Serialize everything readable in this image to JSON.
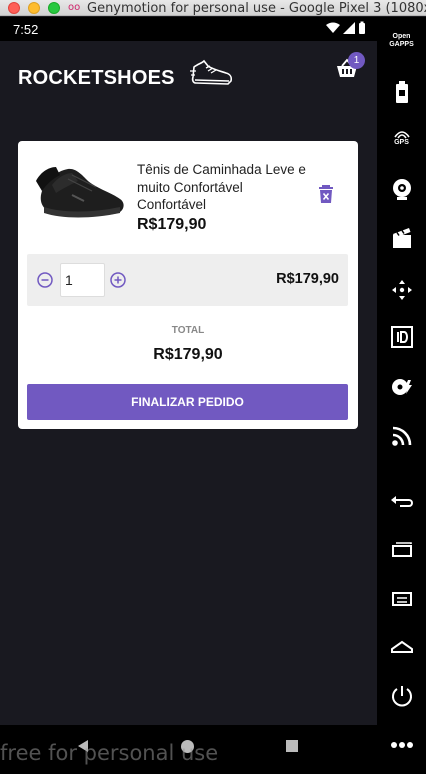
{
  "window": {
    "title": "Genymotion for personal use - Google Pixel 3 (1080x2",
    "logo_glyph": "oo"
  },
  "statusbar": {
    "time": "7:52"
  },
  "header": {
    "logo_text": "ROCKETSHOES",
    "cart_count": "1"
  },
  "cart": {
    "items": [
      {
        "title": "Tênis de Caminhada Leve e muito Confortável Confortável",
        "price": "R$179,90",
        "quantity": "1",
        "subtotal": "R$179,90"
      }
    ],
    "total_label": "TOTAL",
    "total_value": "R$179,90",
    "finish_label": "FINALIZAR PEDIDO"
  },
  "sidebar": {
    "open_gapps_label": "Open\nGAPPS",
    "gps_label": "GPS"
  },
  "watermark": "free for personal use",
  "colors": {
    "accent": "#7159c1",
    "background": "#191920",
    "card": "#ffffff"
  },
  "icons": [
    "cart-icon",
    "trash-icon",
    "minus-circle-icon",
    "plus-circle-icon",
    "battery-icon",
    "gps-icon",
    "camera-icon",
    "film-icon",
    "move-icon",
    "id-icon",
    "disk-icon",
    "cast-icon",
    "back-icon",
    "recent-icon",
    "menu-icon",
    "home-icon",
    "power-icon",
    "more-icon"
  ]
}
